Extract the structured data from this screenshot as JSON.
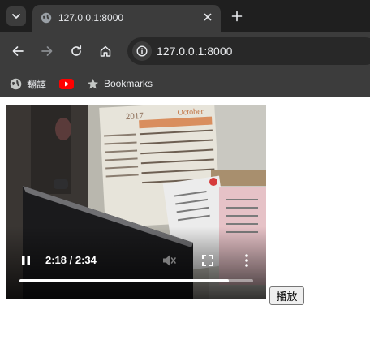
{
  "browser": {
    "tab": {
      "title": "127.0.0.1:8000"
    },
    "address_bar": {
      "url": "127.0.0.1:8000"
    },
    "bookmarks": [
      {
        "label": "翻譯",
        "icon": "globe-icon"
      },
      {
        "label": "",
        "icon": "youtube-icon"
      },
      {
        "label": "Bookmarks",
        "icon": "star-icon"
      }
    ]
  },
  "video": {
    "state": "playing",
    "current_time": "2:18",
    "duration": "2:34",
    "time_display": "2:18 / 2:34",
    "progress_fraction": 0.896,
    "muted": true,
    "calendar_month": "October",
    "calendar_year": "2017"
  },
  "page": {
    "play_button_label": "播放"
  },
  "colors": {
    "chrome_dark": "#1f1f1f",
    "chrome_toolbar": "#3c3c3c",
    "youtube_red": "#ff0000"
  }
}
